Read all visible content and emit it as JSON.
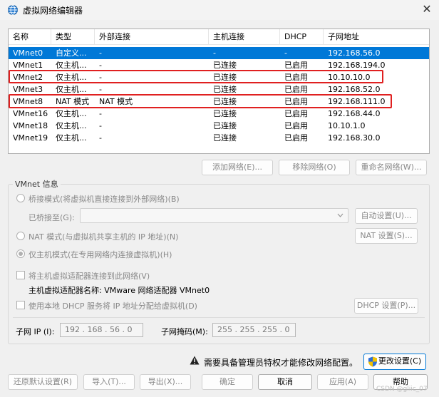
{
  "window": {
    "title": "虚拟网络编辑器",
    "close": "✕"
  },
  "table": {
    "columns": [
      "名称",
      "类型",
      "外部连接",
      "主机连接",
      "DHCP",
      "子网地址"
    ],
    "rows": [
      {
        "name": "VMnet0",
        "type": "自定义...",
        "external": "-",
        "host": "-",
        "dhcp": "-",
        "subnet": "192.168.56.0"
      },
      {
        "name": "VMnet1",
        "type": "仅主机...",
        "external": "-",
        "host": "已连接",
        "dhcp": "已启用",
        "subnet": "192.168.194.0"
      },
      {
        "name": "VMnet2",
        "type": "仅主机...",
        "external": "-",
        "host": "已连接",
        "dhcp": "已启用",
        "subnet": "10.10.10.0"
      },
      {
        "name": "VMnet3",
        "type": "仅主机...",
        "external": "-",
        "host": "已连接",
        "dhcp": "已启用",
        "subnet": "192.168.52.0"
      },
      {
        "name": "VMnet8",
        "type": "NAT 模式",
        "external": "NAT 模式",
        "host": "已连接",
        "dhcp": "已启用",
        "subnet": "192.168.111.0"
      },
      {
        "name": "VMnet16",
        "type": "仅主机...",
        "external": "-",
        "host": "已连接",
        "dhcp": "已启用",
        "subnet": "192.168.44.0"
      },
      {
        "name": "VMnet18",
        "type": "仅主机...",
        "external": "-",
        "host": "已连接",
        "dhcp": "已启用",
        "subnet": "10.10.1.0"
      },
      {
        "name": "VMnet19",
        "type": "仅主机...",
        "external": "-",
        "host": "已连接",
        "dhcp": "已启用",
        "subnet": "192.168.30.0"
      }
    ]
  },
  "net_buttons": {
    "add": "添加网络(E)...",
    "remove": "移除网络(O)",
    "rename": "重命名网络(W)..."
  },
  "vmnet_info": {
    "title": "VMnet 信息",
    "bridged": "桥接模式(将虚拟机直接连接到外部网络)(B)",
    "bridged_to": "已桥接至(G):",
    "auto_settings": "自动设置(U)...",
    "nat": "NAT 模式(与虚拟机共享主机的 IP 地址)(N)",
    "nat_settings": "NAT 设置(S)...",
    "host_only": "仅主机模式(在专用网络内连接虚拟机)(H)",
    "connect_adapter": "将主机虚拟适配器连接到此网络(V)",
    "adapter_name": "主机虚拟适配器名称: VMware 网络适配器 VMnet0",
    "use_dhcp": "使用本地 DHCP 服务将 IP 地址分配给虚拟机(D)",
    "dhcp_settings": "DHCP 设置(P)...",
    "subnet_ip_label": "子网 IP (I):",
    "subnet_ip": "192 . 168 . 56 . 0",
    "subnet_mask_label": "子网掩码(M):",
    "subnet_mask": "255 . 255 . 255 . 0"
  },
  "admin": {
    "warning": "需要具备管理员特权才能修改网络配置。",
    "change": "更改设置(C)"
  },
  "footer": {
    "restore": "还原默认设置(R)",
    "import": "导入(T)...",
    "export": "导出(X)...",
    "ok": "确定",
    "cancel": "取消",
    "apply": "应用(A)",
    "help": "帮助"
  },
  "watermark": "CSDN @gliic_07"
}
